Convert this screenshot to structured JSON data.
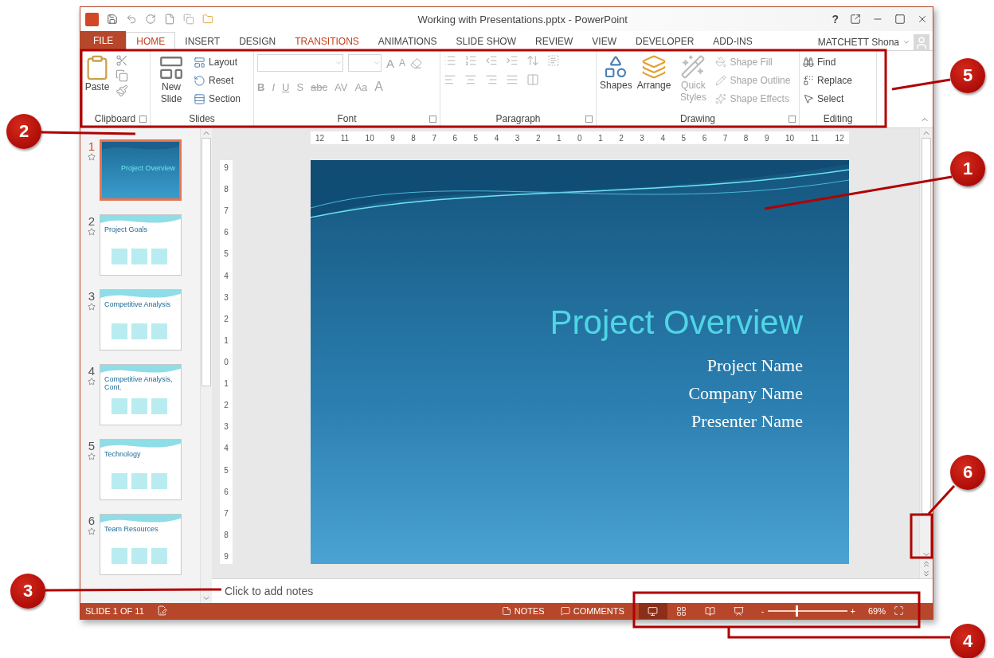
{
  "window": {
    "title": "Working with Presentations.pptx - PowerPoint",
    "help": "?"
  },
  "tabs": [
    {
      "label": "FILE",
      "kind": "file",
      "selected": false
    },
    {
      "label": "HOME",
      "kind": "tab",
      "selected": true
    },
    {
      "label": "INSERT",
      "kind": "tab",
      "selected": false
    },
    {
      "label": "DESIGN",
      "kind": "tab",
      "selected": false
    },
    {
      "label": "TRANSITIONS",
      "kind": "accent",
      "selected": false
    },
    {
      "label": "ANIMATIONS",
      "kind": "tab",
      "selected": false
    },
    {
      "label": "SLIDE SHOW",
      "kind": "tab",
      "selected": false
    },
    {
      "label": "REVIEW",
      "kind": "tab",
      "selected": false
    },
    {
      "label": "VIEW",
      "kind": "tab",
      "selected": false
    },
    {
      "label": "DEVELOPER",
      "kind": "tab",
      "selected": false
    },
    {
      "label": "ADD-INS",
      "kind": "tab",
      "selected": false
    }
  ],
  "user": {
    "name": "MATCHETT Shona"
  },
  "ribbon": {
    "clipboard": {
      "label": "Clipboard",
      "paste": "Paste"
    },
    "slides": {
      "label": "Slides",
      "new_slide": "New Slide",
      "items": [
        "Layout",
        "Reset",
        "Section"
      ]
    },
    "font": {
      "label": "Font",
      "disabled": true,
      "size_buttons": [
        "A",
        "A"
      ],
      "buttons": [
        "B",
        "I",
        "U",
        "S",
        "abc",
        "AV",
        "Aa",
        "A"
      ]
    },
    "paragraph": {
      "label": "Paragraph",
      "disabled": true
    },
    "drawing": {
      "label": "Drawing",
      "big": [
        {
          "label": "Shapes",
          "disabled": false
        },
        {
          "label": "Arrange",
          "disabled": false
        },
        {
          "label": "Quick Styles",
          "disabled": true
        }
      ],
      "items": [
        {
          "label": "Shape Fill",
          "disabled": true
        },
        {
          "label": "Shape Outline",
          "disabled": true
        },
        {
          "label": "Shape Effects",
          "disabled": true
        }
      ]
    },
    "editing": {
      "label": "Editing",
      "items": [
        "Find",
        "Replace",
        "Select"
      ]
    }
  },
  "thumbnails": [
    {
      "number": "1",
      "title": "Project Overview",
      "kind": "title",
      "selected": true
    },
    {
      "number": "2",
      "title": "Project Goals",
      "kind": "content",
      "selected": false
    },
    {
      "number": "3",
      "title": "Competitive Analysis",
      "kind": "content",
      "selected": false
    },
    {
      "number": "4",
      "title": "Competitive Analysis, Cont.",
      "kind": "content",
      "selected": false
    },
    {
      "number": "5",
      "title": "Technology",
      "kind": "content",
      "selected": false
    },
    {
      "number": "6",
      "title": "Team Resources",
      "kind": "content",
      "selected": false
    }
  ],
  "horizontal_ruler": [
    "12",
    "11",
    "10",
    "9",
    "8",
    "7",
    "6",
    "5",
    "4",
    "3",
    "2",
    "1",
    "0",
    "1",
    "2",
    "3",
    "4",
    "5",
    "6",
    "7",
    "8",
    "9",
    "10",
    "11",
    "12"
  ],
  "vertical_ruler": [
    "9",
    "8",
    "7",
    "6",
    "5",
    "4",
    "3",
    "2",
    "1",
    "0",
    "1",
    "2",
    "3",
    "4",
    "5",
    "6",
    "7",
    "8",
    "9"
  ],
  "slide": {
    "title": "Project Overview",
    "lines": [
      "Project Name",
      "Company Name",
      "Presenter Name"
    ]
  },
  "notes": {
    "placeholder": "Click to add notes"
  },
  "status_bar": {
    "slide": "SLIDE 1 OF 11",
    "notes": "NOTES",
    "comments": "COMMENTS",
    "views": [
      {
        "kind": "normal",
        "selected": true
      },
      {
        "kind": "sorter",
        "selected": false
      },
      {
        "kind": "reading",
        "selected": false
      },
      {
        "kind": "slideshow",
        "selected": false
      }
    ],
    "zoom_out": "-",
    "zoom_in": "+",
    "zoom": {
      "level": 0.35
    },
    "zoom_reading": "69%"
  },
  "callouts": [
    {
      "label": "5"
    },
    {
      "label": "2"
    },
    {
      "label": "1"
    },
    {
      "label": "6"
    },
    {
      "label": "3"
    },
    {
      "label": "4"
    }
  ]
}
